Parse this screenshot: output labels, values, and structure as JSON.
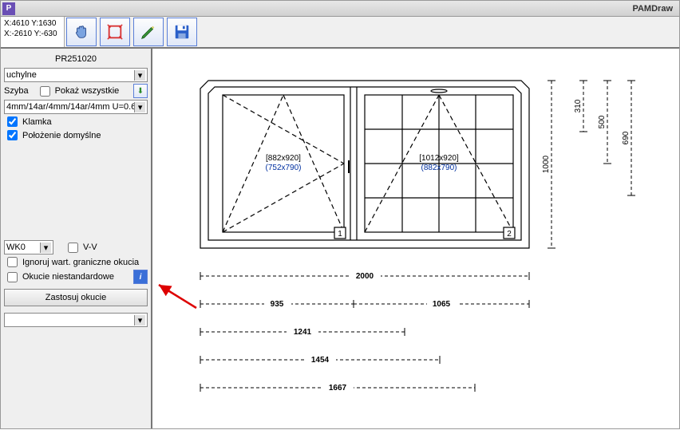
{
  "app": {
    "title": "PAMDraw",
    "icon_letter": "P"
  },
  "coords": {
    "line1": "X:4610 Y:1630",
    "line2": "X:-2610 Y:-630"
  },
  "sidebar": {
    "project": "PR251020",
    "type_select": "uchylne",
    "szyba_label": "Szyba",
    "show_all_label": "Pokaż wszystkie",
    "glass_select": "4mm/14ar/4mm/14ar/4mm U=0.6",
    "klamka_label": "Klamka",
    "polozenie_label": "Położenie domyślne",
    "wk_select": "WK0",
    "vv_label": "V-V",
    "ignore_label": "Ignoruj wart. graniczne okucia",
    "nonstd_label": "Okucie niestandardowe",
    "apply_label": "Zastosuj okucie"
  },
  "drawing": {
    "pane1_dim": "[882x920]",
    "pane1_sub": "(752x790)",
    "pane2_dim": "[1012x920]",
    "pane2_sub": "(882x790)",
    "pane1_num": "1",
    "pane2_num": "2",
    "dim_v_310": "310",
    "dim_v_500": "500",
    "dim_v_690": "690",
    "dim_v_1000": "1000",
    "dim_h_2000": "2000",
    "dim_h_935": "935",
    "dim_h_1065": "1065",
    "dim_h_1241": "1241",
    "dim_h_1454": "1454",
    "dim_h_1667": "1667"
  }
}
